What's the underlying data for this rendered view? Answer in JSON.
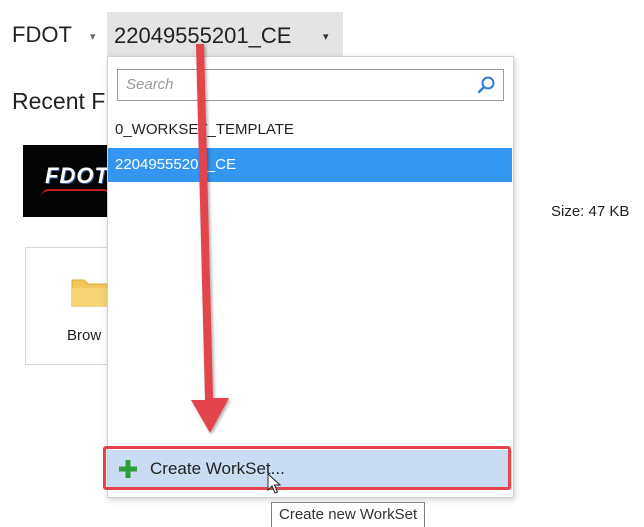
{
  "breadcrumb": {
    "root_label": "FDOT",
    "active_label": "22049555201_CE",
    "chevron": "▾"
  },
  "recent": {
    "heading": "Recent F",
    "thumb_text": "FDOT",
    "browse_label": "Brow",
    "size_text": "Size: 47 KB"
  },
  "dropdown": {
    "search_placeholder": "Search",
    "search_value": "",
    "items": [
      {
        "label": "0_WORKSET_TEMPLATE",
        "selected": false
      },
      {
        "label": "22049555201_CE",
        "selected": true
      }
    ],
    "create_label": "Create WorkSet...",
    "tooltip": "Create new WorkSet"
  },
  "icons": {
    "search": "search-icon",
    "plus": "plus-icon",
    "folder": "folder-icon",
    "cursor": "cursor-icon",
    "chevron": "chevron-down-icon"
  },
  "colors": {
    "selected_bg": "#3396f0",
    "create_row_bg": "#c9dcf1",
    "annotation_red": "#e2454c",
    "plus_green": "#2e9e3a"
  }
}
